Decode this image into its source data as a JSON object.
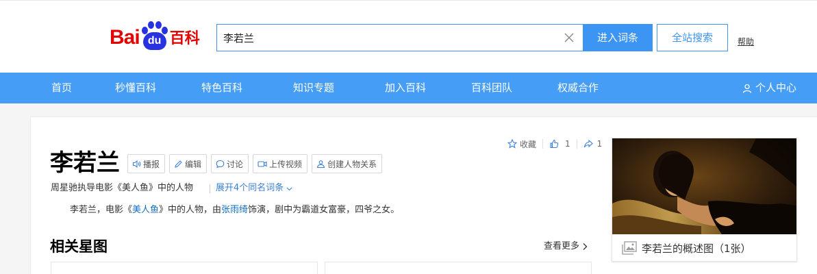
{
  "header": {
    "logo": {
      "bai": "Bai",
      "du": "du",
      "baike": "百科"
    },
    "search": {
      "value": "李若兰",
      "placeholder": ""
    },
    "enter_button": "进入词条",
    "site_search_button": "全站搜索",
    "help_link": "帮助"
  },
  "nav": {
    "items": [
      "首页",
      "秒懂百科",
      "特色百科",
      "知识专题",
      "加入百科",
      "百科团队",
      "权威合作"
    ],
    "user_center": "个人中心"
  },
  "entry": {
    "title": "李若兰",
    "tools": [
      "播报",
      "编辑",
      "讨论",
      "上传视频",
      "创建人物关系"
    ],
    "actions": {
      "collect": "收藏",
      "like_count": "1",
      "share_count": "1"
    },
    "subtitle": "周星驰执导电影《美人鱼》中的人物",
    "expand_link": "展开4个同名词条",
    "summary": {
      "part1": "李若兰，电影《",
      "link1": "美人鱼",
      "part2": "》中的人物，由",
      "link2": "张雨绮",
      "part3": "饰演，剧中为霸道女富豪，四爷之女。"
    },
    "related_section": {
      "title": "相关星图",
      "more": "查看更多"
    },
    "album": {
      "caption": "李若兰的概述图（1张）"
    }
  },
  "colors": {
    "brand_red": "#e10601",
    "brand_blue": "#2932e1",
    "nav_blue": "#459df5",
    "button_blue": "#3c94f3",
    "link_blue": "#136ec2"
  }
}
